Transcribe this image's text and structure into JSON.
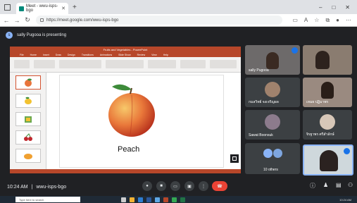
{
  "browser": {
    "tab_title": "Meet - wwu-isps-bgo",
    "url": "https://meet.google.com/wwu-isps-bgo",
    "window_controls": [
      "–",
      "□",
      "✕"
    ]
  },
  "meet": {
    "presenting_text": "sally Pugooa is presenting",
    "meeting_time": "10:24 AM",
    "meeting_code": "wwu-isps-bgo",
    "separator": "|"
  },
  "slide": {
    "label": "Peach",
    "app_title": "Fruits and Vegetables - PowerPoint",
    "ribbon_tabs": [
      "File",
      "Home",
      "Insert",
      "Draw",
      "Design",
      "Transitions",
      "Animations",
      "Slide Show",
      "Review",
      "View",
      "Help"
    ]
  },
  "participants": [
    {
      "name": "sally Pugooa"
    },
    {
      "name": ""
    },
    {
      "name": "กมลวิทย์ จงเจริญผล"
    },
    {
      "name": "เหมย ปฏิมาพร"
    },
    {
      "name": "Sawat Boonsuk"
    },
    {
      "name": "จิรฐาพร ศรีสำลักษ์"
    },
    {
      "name": "10 others"
    },
    {
      "name": ""
    }
  ],
  "taskbar": {
    "search_placeholder": "Type here to search",
    "time": "10:24 AM"
  },
  "colors": {
    "meet_bg": "#202124",
    "tile_bg": "#3c4043",
    "end_call": "#ea4335",
    "ppt_accent": "#b7472a"
  }
}
